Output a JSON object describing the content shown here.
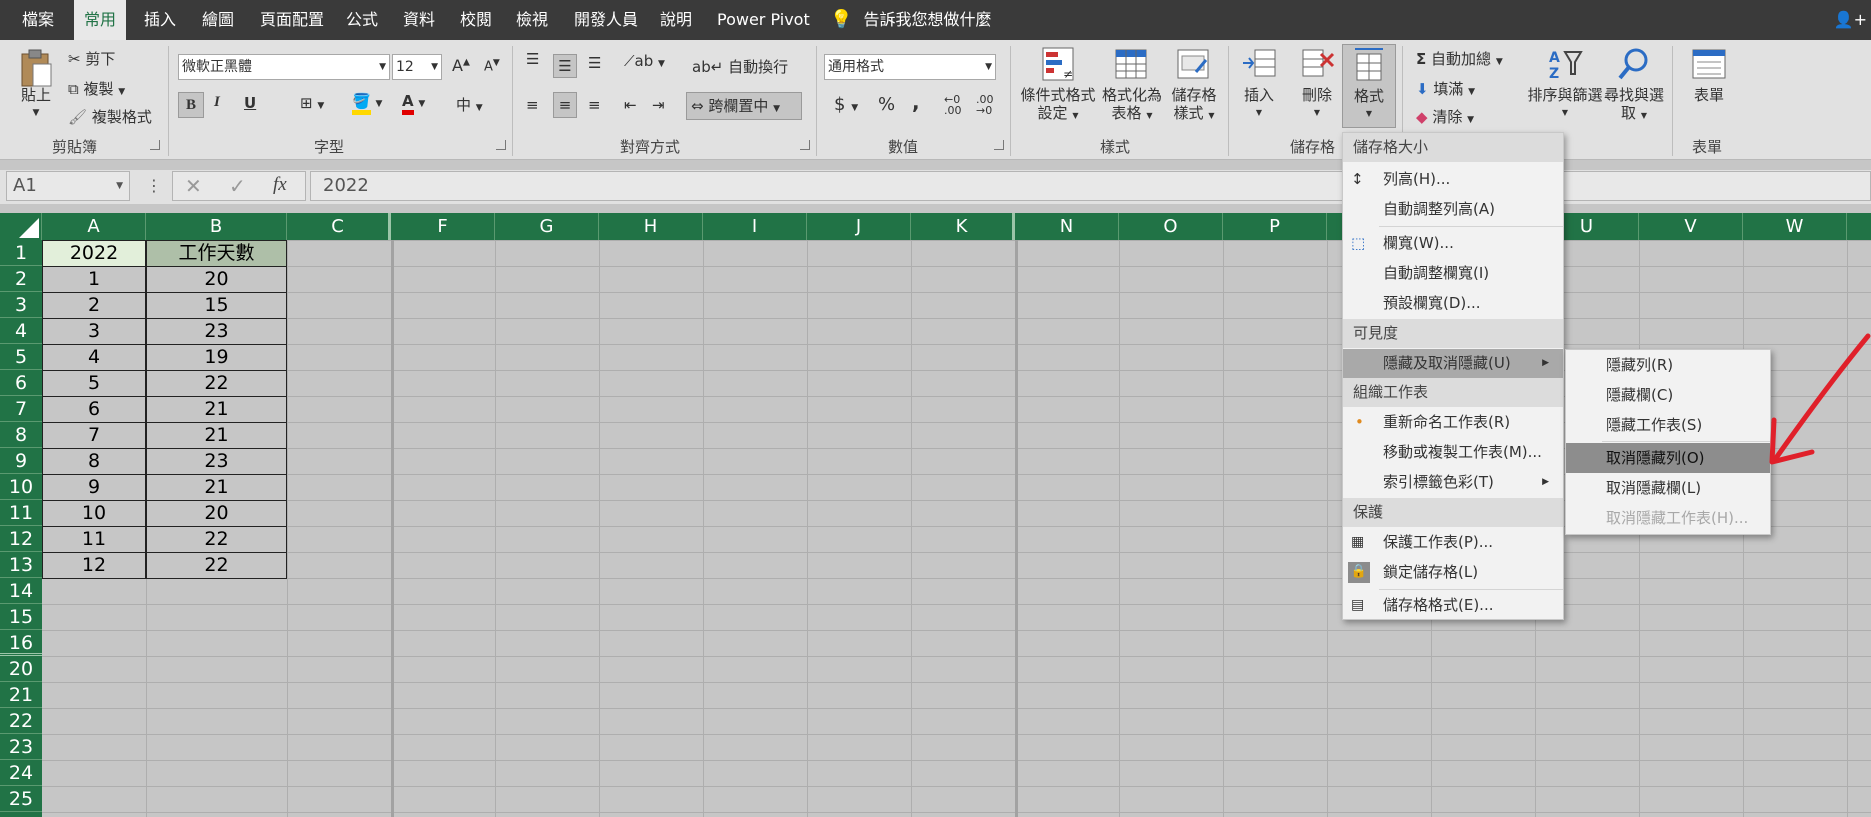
{
  "tabs": [
    "檔案",
    "常用",
    "插入",
    "繪圖",
    "頁面配置",
    "公式",
    "資料",
    "校閱",
    "檢視",
    "開發人員",
    "說明",
    "Power Pivot"
  ],
  "active_tab": "常用",
  "tell_me": "告訴我您想做什麼",
  "clipboard": {
    "paste": "貼上",
    "cut": "剪下",
    "copy": "複製",
    "format_painter": "複製格式",
    "label": "剪貼簿"
  },
  "font": {
    "name": "微軟正黑體",
    "size": "12",
    "bold": "B",
    "italic": "I",
    "underline": "U",
    "grow": "A",
    "shrink": "A",
    "label": "字型",
    "phonetic": "中"
  },
  "alignment": {
    "wrap": "自動換行",
    "merge": "跨欄置中",
    "label": "對齊方式"
  },
  "number": {
    "format": "通用格式",
    "currency": "$",
    "percent": "%",
    "comma": ",",
    "label": "數值"
  },
  "styles": {
    "conditional": "條件式格式設定",
    "table": "格式化為表格",
    "cell_styles": "儲存格樣式",
    "label": "樣式"
  },
  "cells_group": {
    "insert": "插入",
    "delete": "刪除",
    "format": "格式",
    "label": "儲存格"
  },
  "editing": {
    "autosum": "自動加總",
    "fill": "填滿",
    "clear": "清除",
    "sort": "排序與篩選",
    "find": "尋找與選取"
  },
  "forms": {
    "form": "表單",
    "label": "表單"
  },
  "namebox": "A1",
  "formula": "2022",
  "columns": [
    "A",
    "B",
    "C",
    "F",
    "G",
    "H",
    "I",
    "J",
    "K",
    "N",
    "O",
    "P",
    "",
    "",
    "U",
    "V",
    "W"
  ],
  "rows": [
    "1",
    "2",
    "3",
    "4",
    "5",
    "6",
    "7",
    "8",
    "9",
    "10",
    "11",
    "12",
    "13",
    "14",
    "15",
    "16",
    "20",
    "21",
    "22",
    "23",
    "24",
    "25"
  ],
  "table": {
    "header": [
      "2022",
      "工作天數"
    ],
    "rows": [
      [
        "1",
        "20"
      ],
      [
        "2",
        "15"
      ],
      [
        "3",
        "23"
      ],
      [
        "4",
        "19"
      ],
      [
        "5",
        "22"
      ],
      [
        "6",
        "21"
      ],
      [
        "7",
        "21"
      ],
      [
        "8",
        "23"
      ],
      [
        "9",
        "21"
      ],
      [
        "10",
        "20"
      ],
      [
        "11",
        "22"
      ],
      [
        "12",
        "22"
      ]
    ]
  },
  "format_menu": {
    "h_cell_size": "儲存格大小",
    "row_height": "列高(H)...",
    "autofit_row": "自動調整列高(A)",
    "col_width": "欄寬(W)...",
    "autofit_col": "自動調整欄寬(I)",
    "default_width": "預設欄寬(D)...",
    "h_visibility": "可見度",
    "hide_unhide": "隱藏及取消隱藏(U)",
    "h_organize": "組織工作表",
    "rename": "重新命名工作表(R)",
    "move_copy": "移動或複製工作表(M)...",
    "tab_color": "索引標籤色彩(T)",
    "h_protect": "保護",
    "protect_sheet": "保護工作表(P)...",
    "lock_cell": "鎖定儲存格(L)",
    "format_cells": "儲存格格式(E)..."
  },
  "submenu": {
    "hide_rows": "隱藏列(R)",
    "hide_cols": "隱藏欄(C)",
    "hide_sheet": "隱藏工作表(S)",
    "unhide_rows": "取消隱藏列(O)",
    "unhide_cols": "取消隱藏欄(L)",
    "unhide_sheet": "取消隱藏工作表(H)..."
  },
  "colors": {
    "excel_green": "#217346",
    "annotation_red": "#e0202a"
  }
}
